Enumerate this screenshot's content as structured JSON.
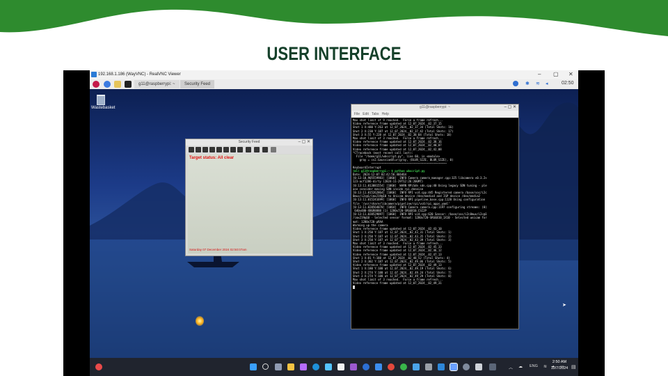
{
  "slide": {
    "title": "USER INTERFACE",
    "colors": {
      "wave": "#2e8b2e",
      "title": "#15402a"
    }
  },
  "vnc": {
    "title": "192.168.1.186 (WayVNC) - RealVNC Viewer",
    "controls": {
      "minimize": "–",
      "maximize": "▢",
      "close": "✕"
    }
  },
  "pi_taskbar": {
    "tasks": [
      "g11@raspberrypi: ~",
      "Security Feed"
    ],
    "time": "02:50",
    "icons": [
      "raspberry-icon",
      "globe-icon",
      "folder-icon",
      "terminal-icon",
      "bluetooth-icon",
      "wifi-icon",
      "volume-icon"
    ]
  },
  "desktop": {
    "trash_label": "Wastebasket"
  },
  "security_feed": {
    "title": "Security Feed",
    "status": "Target status: All clear",
    "timestamp": "Saturday 07 December 2024 02:50:07am"
  },
  "terminal": {
    "title": "g11@raspberrypi: ~",
    "menu": [
      "File",
      "Edit",
      "Tabs",
      "Help"
    ],
    "lines": [
      "Max shot limit of 9 reached.  Force a frame refresh...",
      "Video reference frame updated at 12_07_2024__02_37_15",
      "Shot 1 X:480 Y:263 at 12_07_2024__02_37_34 (Total Shots: 16)",
      "Shot 2 X:230 Y:187 at 12_07_2024__02_37_42 (Total Shots: 17)",
      "Shot 3 X:55 Y:228 at 12_07_2024__02_38_04 (Total Shots: 18)",
      "Max shot limit of 3 reached.  Force a frame refresh...",
      "Video reference frame updated at 12_07_2024__02_38_16",
      "Video reference frame updated at 12_07_2024__02_40_07",
      "Video reference frame updated at 12_07_2024__02_42_08",
      "^CTraceback (most recent call last):",
      "  File \"/home/g11/wbscript.py\", line 60, in <module>",
      "    gray = cv2.GaussianBlur(gray, (BLUR_SIZE, BLUR_SIZE), 0)",
      "           ~~~~~~~~~~~~~~~~~~~~~~~~~~~~~~~~~~~~~~~~~~~~~",
      "KeyboardInterrupt",
      "",
      "(ml) g11@raspberrypi:~ $ python wbscript.py",
      "Date: 2024-12-07 02:42:56.466464",
      "[0:13:10.905559983] [1060]  INFO Camera camera_manager.cpp:325 libcamera v0.3.2+",
      "123-acf1286-dirty (2024-11-29T12:26:20GMT)",
      "[0:13:11.013081554] [1060]  WARN RPiSdn sdn.cpp:40 Using legacy SDN tuning - ple",
      "ase consider moving SDN inside rpi.denoise",
      "[0:13:11.015262864] [1060]  INFO RPI vc4.cpp:445 Registered camera /base/soc/i2c",
      "0mux/i2c@1/imx219@10 to Unicam device /dev/media4 and ISP device /dev/media2",
      "[0:13:11.015241699] [1060]  INFO RPI pipeline_base.cpp:1120 Using configuration",
      "file '/usr/share/libcamera/pipeline/rpi/vc4/rpi_apps.yaml'",
      "[0:13:11.020564070] [1064]  INFO Camera camera.cpp:1197 configuring streams: (0)",
      " 640x480-XBGR8888 (1) 1280x720-SRGGB10_CSI2P",
      "[0:13:11.020529897] [1060]  INFO RPI vc4.cpp:620 Sensor: /base/soc/i2c0mux/i2c@1",
      "/imx219@10 - Selected sensor format: 1280x720-SRGGB10_1X10 - Selected unicam for",
      "mat: 1280x720-pRAA",
      "Warming up the camera",
      "Video reference frame updated at 12_07_2024__02_43_10",
      "Shot 1 X:250 Y:187 at 12_07_2024__02_43_31 (Total Shots: 1)",
      "Shot 2 X:250 Y:187 at 12_07_2024__02_43_35 (Total Shots: 2)",
      "Shot 3 X:250 Y:187 at 12_07_2024__02_43_39 (Total Shots: 3)",
      "Max shot limit of 3 reached.  Force a frame refresh...",
      "Video reference frame updated at 12_07_2024__02_45_33",
      "Video reference frame updated at 12_07_2024__02_46_12",
      "Video reference frame updated at 12_07_2024__02_47_13",
      "Shot 1 X:81 Y:188 at 12_07_2024__02_48_52 (Total Shots: 4)",
      "Shot 2 X:302 Y:187 at 12_07_2024__02_49_06 (Total Shots: 5)",
      "Video reference frame updated at 12_07_2024__02_49_13",
      "Shot 1 X:180 Y:188 at 12_07_2024__02_49_19 (Total Shots: 6)",
      "Shot 2 X:274 Y:188 at 12_07_2024__02_49_24 (Total Shots: 7)",
      "Shot 3 X:274 Y:188 at 12_07_2024__02_49_29 (Total Shots: 8)",
      "Max shot limit of 3 reached.  Force a frame refresh...",
      "Video reference frame updated at 12_07_2024__02_49_31"
    ]
  },
  "windows_taskbar": {
    "time": "2:50 AM",
    "date": "12/7/2024",
    "lang": "ENG"
  }
}
